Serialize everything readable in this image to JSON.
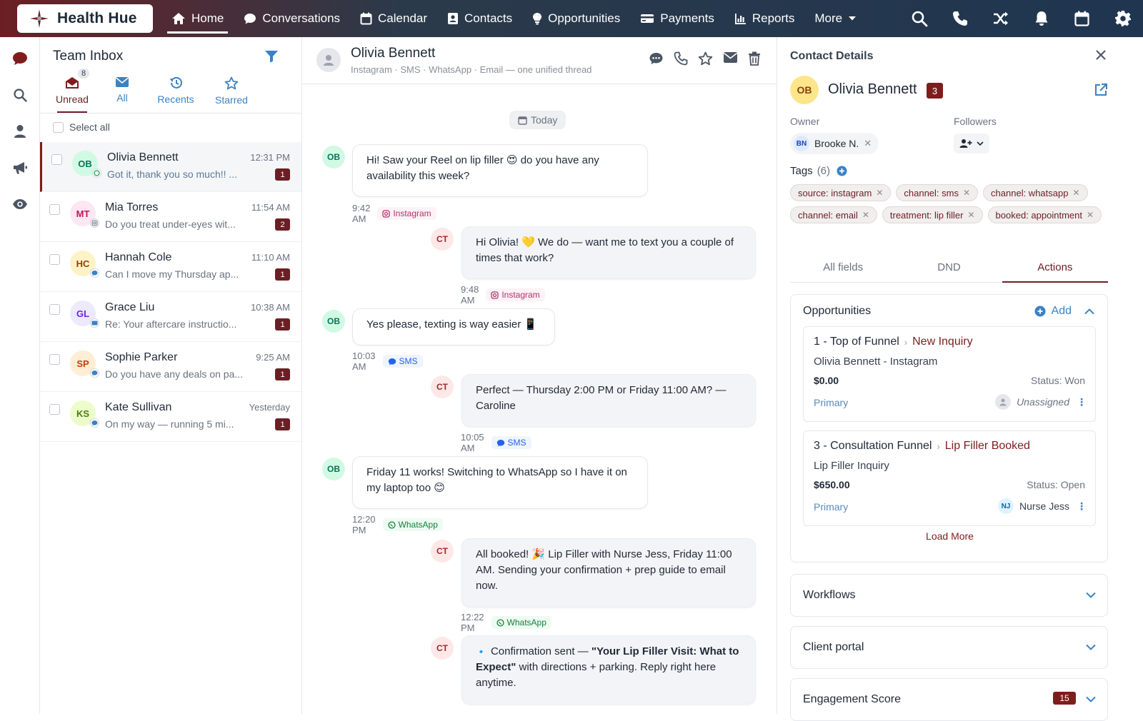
{
  "brand": {
    "name": "Health Hue",
    "accent": "#6b1f24"
  },
  "nav": {
    "items": [
      {
        "label": "Home",
        "icon": "home-icon"
      },
      {
        "label": "Conversations",
        "icon": "chat-icon"
      },
      {
        "label": "Calendar",
        "icon": "calendar-icon"
      },
      {
        "label": "Contacts",
        "icon": "contact-card-icon"
      },
      {
        "label": "Opportunities",
        "icon": "lightbulb-icon"
      },
      {
        "label": "Payments",
        "icon": "credit-card-icon"
      },
      {
        "label": "Reports",
        "icon": "bar-chart-icon"
      },
      {
        "label": "More",
        "icon": "chevron-down-icon"
      }
    ],
    "right_icons": [
      "search-icon",
      "phone-icon",
      "shuffle-icon",
      "bell-icon",
      "calendar-icon",
      "gear-icon"
    ]
  },
  "rail": {
    "icons": [
      "chat-icon",
      "search-icon",
      "user-icon",
      "megaphone-icon",
      "eye-icon"
    ]
  },
  "inbox": {
    "title": "Team Inbox",
    "tabs": [
      {
        "label": "Unread",
        "badge": "8"
      },
      {
        "label": "All"
      },
      {
        "label": "Recents"
      },
      {
        "label": "Starred"
      }
    ],
    "select_all": "Select all",
    "conversations": [
      {
        "initials": "OB",
        "name": "Olivia Bennett",
        "preview": "Got it, thank you so much!! ...",
        "time": "12:31 PM",
        "count": "1",
        "avatar_bg": "#d1fae5",
        "avatar_fg": "#047857",
        "channel": "whatsapp"
      },
      {
        "initials": "MT",
        "name": "Mia Torres",
        "preview": "Do you treat under-eyes wit...",
        "time": "11:54 AM",
        "count": "2",
        "avatar_bg": "#fce7f3",
        "avatar_fg": "#be185d",
        "channel": "instagram"
      },
      {
        "initials": "HC",
        "name": "Hannah Cole",
        "preview": "Can I move my Thursday ap...",
        "time": "11:10 AM",
        "count": "1",
        "avatar_bg": "#fef3c7",
        "avatar_fg": "#92400e",
        "channel": "sms"
      },
      {
        "initials": "GL",
        "name": "Grace Liu",
        "preview": "Re: Your aftercare instructio...",
        "time": "10:38 AM",
        "count": "1",
        "avatar_bg": "#ede9fe",
        "avatar_fg": "#6d28d9",
        "channel": "email"
      },
      {
        "initials": "SP",
        "name": "Sophie Parker",
        "preview": "Do you have any deals on pa...",
        "time": "9:25 AM",
        "count": "1",
        "avatar_bg": "#ffedd5",
        "avatar_fg": "#c2410c",
        "channel": "sms"
      },
      {
        "initials": "KS",
        "name": "Kate Sullivan",
        "preview": "On my way — running 5 mi...",
        "time": "Yesterday",
        "count": "1",
        "avatar_bg": "#ecfccb",
        "avatar_fg": "#4d7c0f",
        "channel": "sms"
      }
    ]
  },
  "thread": {
    "name": "Olivia Bennett",
    "subtitle": "Instagram · SMS · WhatsApp · Email — one unified thread",
    "header_icons": [
      "chat-icon",
      "phone-icon",
      "star-icon",
      "mail-icon",
      "trash-icon"
    ],
    "date_pill": "Today",
    "messages": [
      {
        "dir": "in",
        "initials": "OB",
        "text": "Hi! Saw your Reel on lip filler 😍 do you have any availability this week?",
        "time": "9:42 AM",
        "channel": "Instagram"
      },
      {
        "dir": "out",
        "initials": "CT",
        "text": "Hi Olivia! 💛 We do — want me to text you a couple of times that work?",
        "time": "9:48 AM",
        "channel": "Instagram"
      },
      {
        "dir": "in",
        "initials": "OB",
        "text": "Yes please, texting is way easier 📱",
        "time": "10:03 AM",
        "channel": "SMS"
      },
      {
        "dir": "out",
        "initials": "CT",
        "text": "Perfect — Thursday 2:00 PM or Friday 11:00 AM? — Caroline",
        "time": "10:05 AM",
        "channel": "SMS"
      },
      {
        "dir": "in",
        "initials": "OB",
        "text": "Friday 11 works! Switching to WhatsApp so I have it on my laptop too 😊",
        "time": "12:20 PM",
        "channel": "WhatsApp"
      },
      {
        "dir": "out",
        "initials": "CT",
        "text": "All booked! 🎉 Lip Filler with Nurse Jess, Friday 11:00 AM. Sending your confirmation + prep guide to email now.",
        "time": "12:22 PM",
        "channel": "WhatsApp"
      },
      {
        "dir": "out",
        "initials": "CT",
        "text_pre": "Confirmation sent — ",
        "text_bold": "\"Your Lip Filler Visit: What to Expect\"",
        "text_post": " with directions + parking. Reply right here anytime."
      }
    ]
  },
  "details": {
    "title": "Contact Details",
    "initials": "OB",
    "name": "Olivia Bennett",
    "badge": "3",
    "owner_label": "Owner",
    "owner_initials": "BN",
    "owner_name": "Brooke N.",
    "followers_label": "Followers",
    "tags_label": "Tags",
    "tags_count": "(6)",
    "tags": [
      "source: instagram",
      "channel: sms",
      "channel: whatsapp",
      "channel: email",
      "treatment: lip filler",
      "booked: appointment"
    ],
    "tabs": [
      "All fields",
      "DND",
      "Actions"
    ],
    "active_tab": "Actions",
    "opportunities": {
      "title": "Opportunities",
      "add_label": "Add",
      "items": [
        {
          "pipeline": "1 - Top of Funnel",
          "stage": "New Inquiry",
          "name": "Olivia Bennett - Instagram",
          "value": "$0.00",
          "status": "Status: Won",
          "primary": "Primary",
          "assignee": "Unassigned",
          "assignee_initials": ""
        },
        {
          "pipeline": "3 - Consultation Funnel",
          "stage": "Lip Filler Booked",
          "name": "Lip Filler Inquiry",
          "value": "$650.00",
          "status": "Status: Open",
          "primary": "Primary",
          "assignee": "Nurse Jess",
          "assignee_initials": "NJ"
        }
      ],
      "load_more": "Load More"
    },
    "sections": [
      {
        "title": "Workflows"
      },
      {
        "title": "Client portal"
      },
      {
        "title": "Engagement Score",
        "badge": "15"
      }
    ]
  }
}
